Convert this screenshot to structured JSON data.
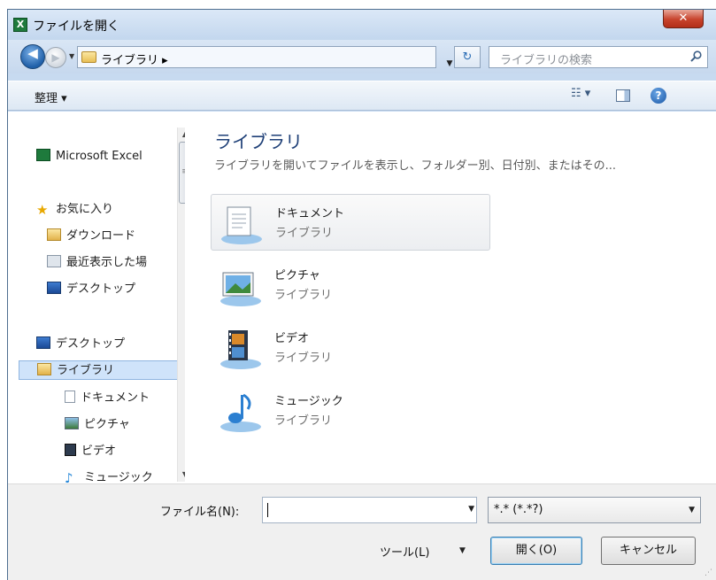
{
  "window": {
    "title": "ファイルを開く",
    "app_icon": "X",
    "close_glyph": "✕"
  },
  "nav": {
    "back_glyph": "◀",
    "forward_glyph": "▶",
    "history_glyph": "▼",
    "address": "ライブラリ ▸",
    "address_sep": "▸",
    "refresh_glyph": "↻",
    "dropdown_glyph": "▼",
    "search_placeholder": "ライブラリの検索"
  },
  "toolbar": {
    "organize": "整理 ▾",
    "view_glyph": "☷ ▾",
    "help_glyph": "?"
  },
  "sidebar": {
    "items": [
      {
        "label": "Microsoft Excel",
        "icon": "excel-icon"
      },
      {
        "label": "お気に入り",
        "icon": "star-icon"
      },
      {
        "label": "ダウンロード",
        "icon": "download-folder-icon"
      },
      {
        "label": "最近表示した場",
        "icon": "recent-places-icon"
      },
      {
        "label": "デスクトップ",
        "icon": "desktop-icon"
      },
      {
        "label": "デスクトップ",
        "icon": "desktop-icon"
      },
      {
        "label": "ライブラリ",
        "icon": "library-icon"
      },
      {
        "label": "ドキュメント",
        "icon": "document-icon"
      },
      {
        "label": "ピクチャ",
        "icon": "picture-icon"
      },
      {
        "label": "ビデオ",
        "icon": "video-icon"
      },
      {
        "label": "ミュージック",
        "icon": "music-icon"
      }
    ],
    "scroll_up": "▲",
    "scroll_down": "▼",
    "thumb_grip": "≡"
  },
  "main": {
    "title": "ライブラリ",
    "description": "ライブラリを開いてファイルを表示し、フォルダー別、日付別、またはその...",
    "libraries": [
      {
        "name": "ドキュメント",
        "type": "ライブラリ",
        "icon": "documents-library-icon"
      },
      {
        "name": "ピクチャ",
        "type": "ライブラリ",
        "icon": "pictures-library-icon"
      },
      {
        "name": "ビデオ",
        "type": "ライブラリ",
        "icon": "videos-library-icon"
      },
      {
        "name": "ミュージック",
        "type": "ライブラリ",
        "icon": "music-library-icon"
      }
    ]
  },
  "footer": {
    "filename_label": "ファイル名(N):",
    "filename_value": "",
    "filter": "*.* (*.*?)",
    "tools": "ツール(L)",
    "dropdown_glyph": "▼",
    "open": "開く(O)",
    "cancel": "キャンセル",
    "grip": "⋰"
  },
  "colors": {
    "accent": "#1e3f77",
    "selection": "#cfe3fa",
    "chrome": "#c7daf0"
  }
}
